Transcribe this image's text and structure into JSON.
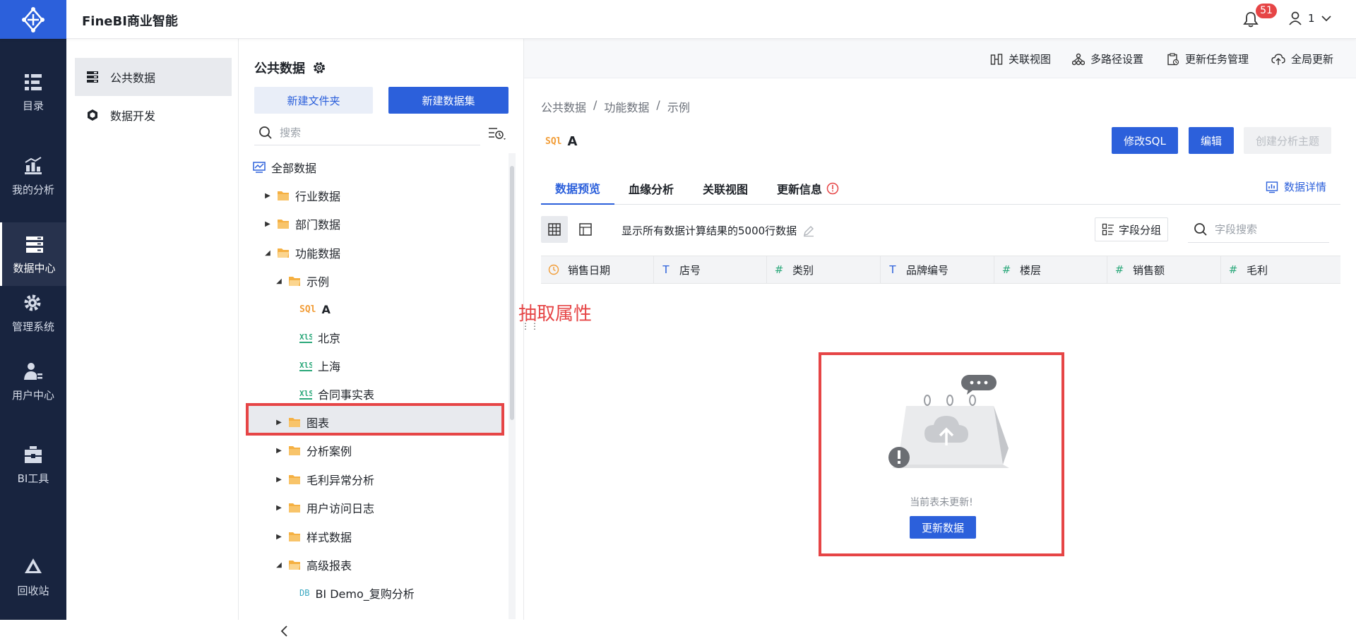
{
  "app": {
    "title": "FineBI商业智能"
  },
  "header": {
    "notification_count": "51",
    "user_name": "1"
  },
  "rail": {
    "items": [
      {
        "label": "目录",
        "icon": "catalog-icon"
      },
      {
        "label": "我的分析",
        "icon": "analysis-icon"
      },
      {
        "label": "数据中心",
        "icon": "data-center-icon",
        "active": true
      },
      {
        "label": "管理系统",
        "icon": "gear-icon"
      },
      {
        "label": "用户中心",
        "icon": "user-center-icon"
      },
      {
        "label": "BI工具",
        "icon": "toolbox-icon"
      },
      {
        "label": "回收站",
        "icon": "recycle-icon"
      }
    ]
  },
  "sub_nav": {
    "items": [
      {
        "label": "公共数据",
        "icon": "public-data-icon",
        "active": true
      },
      {
        "label": "数据开发",
        "icon": "data-dev-icon"
      }
    ]
  },
  "tree": {
    "title": "公共数据",
    "new_folder": "新建文件夹",
    "new_dataset": "新建数据集",
    "search_placeholder": "搜索",
    "nodes": [
      {
        "label": "全部数据",
        "kind": "root"
      },
      {
        "label": "行业数据",
        "kind": "folder",
        "state": "collapsed"
      },
      {
        "label": "部门数据",
        "kind": "folder",
        "state": "collapsed"
      },
      {
        "label": "功能数据",
        "kind": "folder",
        "state": "expanded"
      },
      {
        "label": "示例",
        "kind": "folder",
        "state": "expanded"
      },
      {
        "label": "A",
        "kind": "sql",
        "selected": true
      },
      {
        "label": "北京",
        "kind": "xls"
      },
      {
        "label": "上海",
        "kind": "xls"
      },
      {
        "label": "合同事实表",
        "kind": "xls"
      },
      {
        "label": "图表",
        "kind": "folder",
        "state": "collapsed"
      },
      {
        "label": "分析案例",
        "kind": "folder",
        "state": "collapsed"
      },
      {
        "label": "毛利异常分析",
        "kind": "folder",
        "state": "collapsed"
      },
      {
        "label": "用户访问日志",
        "kind": "folder",
        "state": "collapsed"
      },
      {
        "label": "样式数据",
        "kind": "folder",
        "state": "collapsed"
      },
      {
        "label": "高级报表",
        "kind": "folder",
        "state": "expanded"
      },
      {
        "label": "BI Demo_复购分析",
        "kind": "db"
      }
    ]
  },
  "annotation": "抽取属性",
  "toolbar": {
    "items": [
      "关联视图",
      "多路径设置",
      "更新任务管理",
      "全局更新"
    ]
  },
  "breadcrumb": [
    "公共数据",
    "/",
    "功能数据",
    "/",
    "示例"
  ],
  "table": {
    "name": "A",
    "type_tag": "sql"
  },
  "actions": {
    "edit_sql": "修改SQL",
    "edit": "编辑",
    "create_topic": "创建分析主题"
  },
  "tabs": [
    "数据预览",
    "血缘分析",
    "关联视图",
    "更新信息"
  ],
  "data_detail": "数据详情",
  "preview": {
    "rows_text": "显示所有数据计算结果的5000行数据",
    "group_label": "字段分组",
    "field_search_placeholder": "字段搜索",
    "columns": [
      {
        "name": "销售日期",
        "type": "date"
      },
      {
        "name": "店号",
        "type": "text"
      },
      {
        "name": "类别",
        "type": "number"
      },
      {
        "name": "品牌编号",
        "type": "text"
      },
      {
        "name": "楼层",
        "type": "number"
      },
      {
        "name": "销售额",
        "type": "number"
      },
      {
        "name": "毛利",
        "type": "number"
      }
    ]
  },
  "empty": {
    "message": "当前表未更新!",
    "update_button": "更新数据"
  },
  "colors": {
    "brand": "#2c60db",
    "rail": "#18243f",
    "alert": "#e64546"
  }
}
